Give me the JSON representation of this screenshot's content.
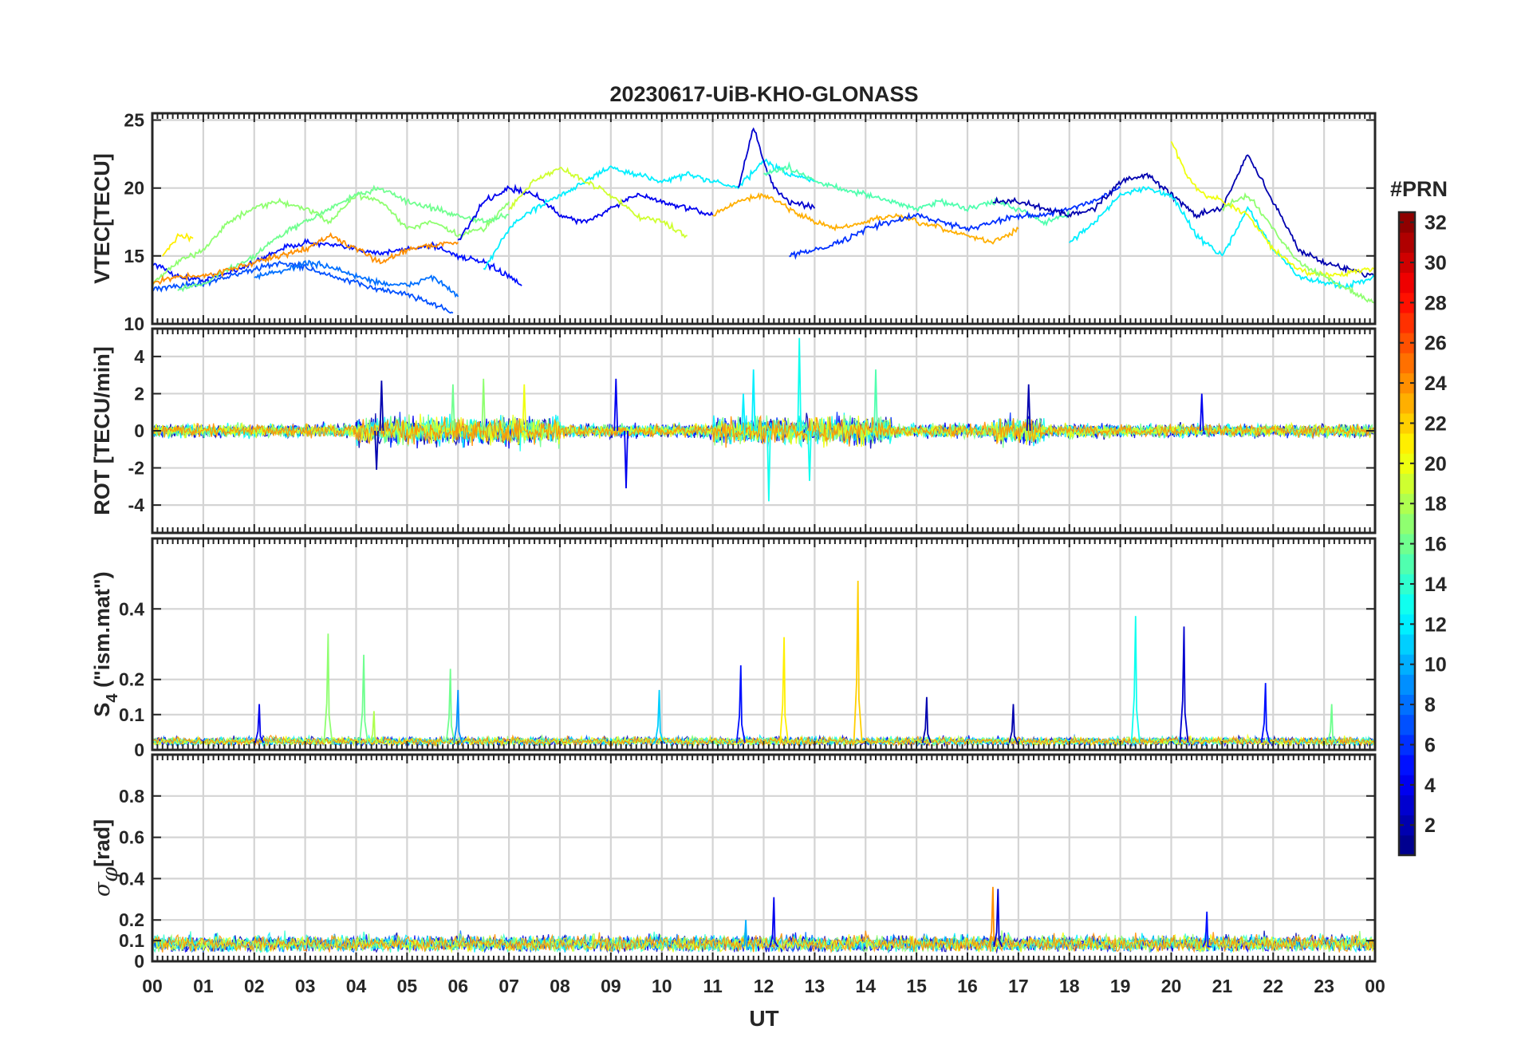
{
  "figure": {
    "title": "20230617-UiB-KHO-GLONASS",
    "xlabel": "UT",
    "x_ticks": [
      "00",
      "01",
      "02",
      "03",
      "04",
      "05",
      "06",
      "07",
      "08",
      "09",
      "10",
      "11",
      "12",
      "13",
      "14",
      "15",
      "16",
      "17",
      "18",
      "19",
      "20",
      "21",
      "22",
      "23",
      "00"
    ]
  },
  "colorbar": {
    "title": "#PRN",
    "range": [
      1,
      32
    ],
    "colormap": "jet",
    "ticks": [
      2,
      4,
      6,
      8,
      10,
      12,
      14,
      16,
      18,
      20,
      22,
      24,
      26,
      28,
      30,
      32
    ]
  },
  "chart_data": [
    {
      "type": "line",
      "panel": "vtec",
      "ylabel": "VTEC[TECU]",
      "ylim": [
        10,
        25.5
      ],
      "yticks": [
        10,
        15,
        20,
        25
      ],
      "xlim": [
        0,
        24
      ],
      "grid": true,
      "series": [
        {
          "prn": 5,
          "x": [
            0,
            0.5,
            1,
            1.5,
            2,
            2.5,
            3,
            3.5,
            4,
            4.5,
            5,
            5.5,
            6,
            6.5,
            7,
            7.25
          ],
          "y": [
            14.5,
            13.5,
            13.2,
            13.8,
            14.5,
            15.5,
            16.0,
            15.8,
            15.5,
            15.2,
            15.5,
            15.8,
            15.0,
            14.5,
            13.5,
            12.8
          ]
        },
        {
          "prn": 7,
          "x": [
            0,
            0.5,
            1,
            1.5,
            2,
            2.5,
            3,
            3.5,
            4,
            4.5,
            5,
            5.5,
            5.9
          ],
          "y": [
            12.5,
            12.8,
            13.0,
            13.5,
            14.0,
            14.5,
            14.2,
            13.5,
            13.0,
            12.5,
            12.2,
            11.5,
            10.8
          ]
        },
        {
          "prn": 8,
          "x": [
            2,
            2.5,
            3,
            3.5,
            4,
            4.5,
            5,
            5.5,
            6
          ],
          "y": [
            13.5,
            13.8,
            14.5,
            14.2,
            13.5,
            13.0,
            12.8,
            13.5,
            12.0
          ]
        },
        {
          "prn": 17,
          "x": [
            0,
            0.5,
            1,
            1.5,
            2,
            2.5,
            3,
            3.5,
            4,
            4.5,
            5,
            5.5,
            6,
            6.5,
            7
          ],
          "y": [
            13.0,
            14.5,
            15.5,
            17.5,
            18.5,
            19.0,
            18.5,
            17.5,
            19.5,
            19.0,
            17.0,
            17.5,
            16.5,
            17.0,
            19.0
          ]
        },
        {
          "prn": 16,
          "x": [
            0.5,
            1,
            1.5,
            2,
            2.5,
            3,
            3.5,
            4,
            4.5,
            5,
            5.5,
            6,
            6.5,
            7
          ],
          "y": [
            12.5,
            13.0,
            14.0,
            15.0,
            16.5,
            17.5,
            18.5,
            19.5,
            20.0,
            19.0,
            18.5,
            18.0,
            17.5,
            18.0
          ]
        },
        {
          "prn": 24,
          "x": [
            0,
            0.5,
            1,
            1.5,
            2,
            2.5,
            3,
            3.5,
            4,
            4.5,
            5,
            5.5,
            6
          ],
          "y": [
            13.0,
            13.5,
            13.5,
            14.0,
            14.5,
            15.0,
            15.5,
            16.5,
            15.5,
            14.5,
            15.5,
            15.8,
            16.0
          ]
        },
        {
          "prn": 21,
          "x": [
            0.2,
            0.5,
            0.8
          ],
          "y": [
            15.0,
            16.5,
            16.3
          ]
        },
        {
          "prn": 4,
          "x": [
            6,
            6.5,
            7,
            7.5,
            8,
            8.5,
            9,
            9.5,
            10,
            10.5,
            11
          ],
          "y": [
            16.0,
            19.0,
            20.0,
            19.5,
            18.0,
            17.5,
            18.5,
            19.5,
            19.0,
            18.5,
            18.0
          ]
        },
        {
          "prn": 12,
          "x": [
            6.5,
            7,
            7.5,
            8,
            8.5,
            9,
            9.5,
            10,
            10.5,
            11,
            11.5,
            12,
            12.5,
            13
          ],
          "y": [
            14.0,
            17.0,
            18.5,
            19.5,
            20.5,
            21.5,
            21.0,
            20.5,
            21.0,
            20.5,
            20.0,
            22.0,
            21.0,
            20.5
          ]
        },
        {
          "prn": 19,
          "x": [
            7,
            7.5,
            8,
            8.5,
            9,
            9.5,
            10,
            10.5
          ],
          "y": [
            18.5,
            20.5,
            21.5,
            20.5,
            19.5,
            18.0,
            17.5,
            16.5
          ]
        },
        {
          "prn": 3,
          "x": [
            11.5,
            11.8,
            12,
            12.2,
            12.5,
            13
          ],
          "y": [
            20.0,
            24.5,
            22.0,
            20.0,
            19.0,
            18.5
          ]
        },
        {
          "prn": 23,
          "x": [
            11,
            11.5,
            12,
            12.5,
            13,
            13.5,
            14,
            14.5,
            15,
            15.5,
            16,
            16.5,
            17
          ],
          "y": [
            18.0,
            19.0,
            19.5,
            18.5,
            17.5,
            17.0,
            17.5,
            18.0,
            17.5,
            17.0,
            16.5,
            16.0,
            17.0
          ]
        },
        {
          "prn": 15,
          "x": [
            12,
            12.5,
            13,
            13.5,
            14,
            14.5,
            15,
            15.5,
            16,
            16.5,
            17,
            17.5,
            18
          ],
          "y": [
            21.0,
            21.5,
            20.5,
            20.0,
            19.5,
            19.0,
            18.5,
            19.0,
            18.5,
            19.0,
            18.5,
            17.5,
            18.0
          ]
        },
        {
          "prn": 6,
          "x": [
            12.5,
            13,
            13.5,
            14,
            14.5,
            15,
            15.5,
            16,
            16.5,
            17,
            17.5,
            18,
            18.5,
            19
          ],
          "y": [
            15.0,
            15.5,
            16.0,
            17.0,
            17.5,
            18.0,
            17.5,
            17.0,
            17.5,
            18.0,
            18.0,
            18.5,
            19.0,
            20.0
          ]
        },
        {
          "prn": 2,
          "x": [
            16.5,
            17,
            17.5,
            18,
            18.5,
            19,
            19.5,
            20,
            20.5,
            21,
            21.5,
            22,
            22.5,
            23,
            23.5,
            24
          ],
          "y": [
            19.0,
            19.0,
            18.5,
            18.0,
            18.5,
            20.5,
            21.0,
            19.5,
            18.0,
            18.5,
            22.5,
            19.0,
            15.5,
            14.5,
            14.0,
            13.5
          ]
        },
        {
          "prn": 12,
          "x": [
            18,
            18.5,
            19,
            19.5,
            20,
            20.5,
            21,
            21.5,
            22,
            22.5,
            23,
            23.5,
            24
          ],
          "y": [
            16.0,
            17.5,
            19.5,
            20.0,
            19.5,
            16.5,
            15.0,
            18.5,
            15.5,
            13.5,
            13.0,
            12.8,
            13.5
          ]
        },
        {
          "prn": 20,
          "x": [
            20,
            20.3,
            20.6,
            21,
            21.5,
            22,
            22.5,
            23,
            23.5,
            24
          ],
          "y": [
            23.5,
            21.0,
            19.5,
            19.0,
            18.0,
            15.5,
            14.0,
            13.5,
            13.8,
            14.0
          ]
        },
        {
          "prn": 17,
          "x": [
            21,
            21.5,
            22,
            22.5,
            23,
            23.5,
            24
          ],
          "y": [
            18.5,
            19.5,
            17.0,
            14.5,
            13.5,
            12.5,
            11.5
          ]
        }
      ]
    },
    {
      "type": "line",
      "panel": "rot",
      "ylabel": "ROT [TECU/min]",
      "ylim": [
        -5.5,
        5.5
      ],
      "yticks": [
        -4,
        -2,
        0,
        2,
        4
      ],
      "xlim": [
        0,
        24
      ],
      "grid": true,
      "series_prns": [
        2,
        4,
        6,
        12,
        13,
        16,
        17,
        20,
        24
      ],
      "spikes": [
        {
          "x": 4.5,
          "y": 2.7,
          "prn": 2
        },
        {
          "x": 4.4,
          "y": -2.1,
          "prn": 2
        },
        {
          "x": 5.9,
          "y": 2.5,
          "prn": 16
        },
        {
          "x": 6.5,
          "y": 2.8,
          "prn": 17
        },
        {
          "x": 7.3,
          "y": 2.5,
          "prn": 20
        },
        {
          "x": 9.1,
          "y": 2.8,
          "prn": 4
        },
        {
          "x": 9.3,
          "y": -3.1,
          "prn": 4
        },
        {
          "x": 11.6,
          "y": 2.0,
          "prn": 12
        },
        {
          "x": 11.8,
          "y": 3.3,
          "prn": 12
        },
        {
          "x": 12.1,
          "y": -3.8,
          "prn": 13
        },
        {
          "x": 12.7,
          "y": 5.0,
          "prn": 13
        },
        {
          "x": 12.9,
          "y": -2.7,
          "prn": 13
        },
        {
          "x": 14.2,
          "y": 3.3,
          "prn": 15
        },
        {
          "x": 17.2,
          "y": 2.5,
          "prn": 2
        },
        {
          "x": 20.6,
          "y": 2.0,
          "prn": 4
        }
      ]
    },
    {
      "type": "line",
      "panel": "s4",
      "ylabel": "S4 (\"ism.mat\")",
      "ylabel_main": "S",
      "ylabel_sub": "4",
      "ylabel_rest": " (\"ism.mat\")",
      "ylim": [
        0,
        0.6
      ],
      "yticks": [
        0,
        0.1,
        0.2,
        0.4
      ],
      "xlim": [
        0,
        24
      ],
      "grid": true,
      "baseline": 0.02,
      "spikes": [
        {
          "x": 2.1,
          "y": 0.13,
          "prn": 4
        },
        {
          "x": 3.45,
          "y": 0.33,
          "prn": 17
        },
        {
          "x": 4.15,
          "y": 0.27,
          "prn": 16
        },
        {
          "x": 4.35,
          "y": 0.11,
          "prn": 18
        },
        {
          "x": 5.85,
          "y": 0.23,
          "prn": 16
        },
        {
          "x": 6.0,
          "y": 0.17,
          "prn": 9
        },
        {
          "x": 9.95,
          "y": 0.17,
          "prn": 11
        },
        {
          "x": 11.55,
          "y": 0.24,
          "prn": 5
        },
        {
          "x": 12.4,
          "y": 0.32,
          "prn": 21
        },
        {
          "x": 13.85,
          "y": 0.48,
          "prn": 22
        },
        {
          "x": 15.2,
          "y": 0.15,
          "prn": 2
        },
        {
          "x": 16.9,
          "y": 0.13,
          "prn": 2
        },
        {
          "x": 19.3,
          "y": 0.38,
          "prn": 13
        },
        {
          "x": 20.25,
          "y": 0.35,
          "prn": 3
        },
        {
          "x": 21.85,
          "y": 0.19,
          "prn": 5
        },
        {
          "x": 23.15,
          "y": 0.13,
          "prn": 16
        }
      ]
    },
    {
      "type": "line",
      "panel": "sigma_phi",
      "ylabel": "σφ[rad]",
      "ylabel_sym": "σ",
      "ylabel_sub": "φ",
      "ylabel_rest": "[rad]",
      "ylim": [
        0,
        1.0
      ],
      "yticks": [
        0,
        0.1,
        0.2,
        0.4,
        0.6,
        0.8
      ],
      "xlim": [
        0,
        24
      ],
      "grid": true,
      "baseline": 0.07,
      "spikes": [
        {
          "x": 11.65,
          "y": 0.2,
          "prn": 10
        },
        {
          "x": 12.2,
          "y": 0.31,
          "prn": 4
        },
        {
          "x": 16.5,
          "y": 0.36,
          "prn": 24
        },
        {
          "x": 16.6,
          "y": 0.35,
          "prn": 3
        },
        {
          "x": 20.7,
          "y": 0.24,
          "prn": 5
        }
      ]
    }
  ]
}
